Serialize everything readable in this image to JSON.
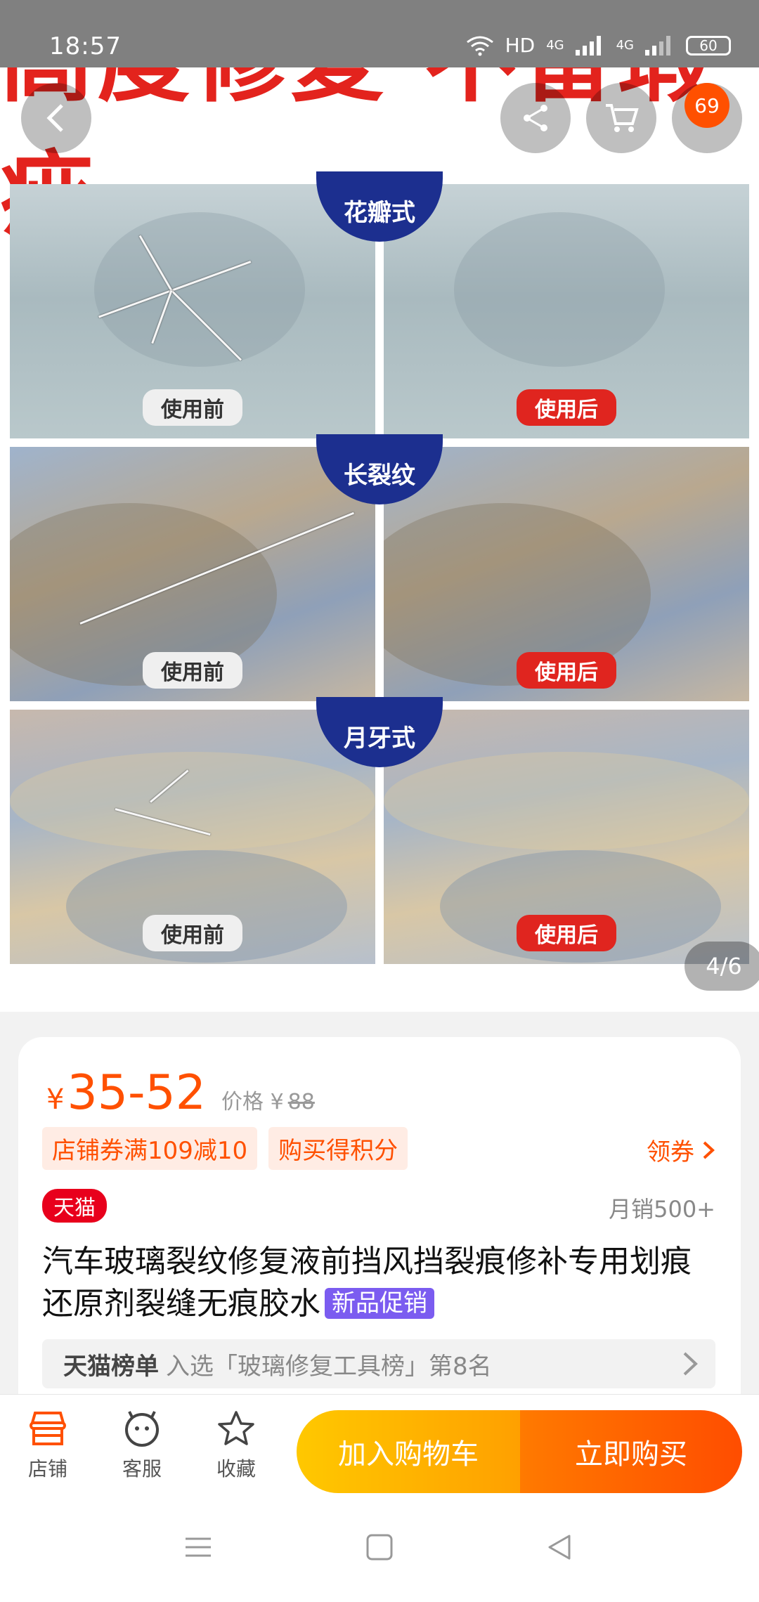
{
  "status_bar": {
    "time": "18:57",
    "network_hd": "HD",
    "network_4g_1": "4G",
    "network_4g_2": "4G",
    "battery": "60"
  },
  "hero": {
    "banner_text": "高度修复 不留瑕疵",
    "rows": [
      {
        "category": "花瓣式",
        "before": "使用前",
        "after": "使用后"
      },
      {
        "category": "长裂纹",
        "before": "使用前",
        "after": "使用后"
      },
      {
        "category": "月牙式",
        "before": "使用前",
        "after": "使用后"
      }
    ],
    "cart_count": "69",
    "page_indicator": "4/6"
  },
  "product": {
    "currency": "¥",
    "price_range": "35-52",
    "price_label": "价格 ¥",
    "original_price": "88",
    "coupons": [
      "店铺券满109减10",
      "购买得积分"
    ],
    "get_coupon": "领券",
    "tmall_badge": "天猫",
    "monthly_sales": "月销500+",
    "title": "汽车玻璃裂纹修复液前挡风挡裂痕修补专用划痕还原剂裂缝无痕胶水",
    "promo_tag": "新品促销",
    "rank_title": "天猫榜单",
    "rank_text": "入选「玻璃修复工具榜」第8名"
  },
  "bottom_bar": {
    "shop": "店铺",
    "service": "客服",
    "favorite": "收藏",
    "add_to_cart": "加入购物车",
    "buy_now": "立即购买"
  },
  "colors": {
    "accent": "#ff5000",
    "tmall_red": "#e8001c",
    "promo_purple": "#7b5cf0"
  }
}
